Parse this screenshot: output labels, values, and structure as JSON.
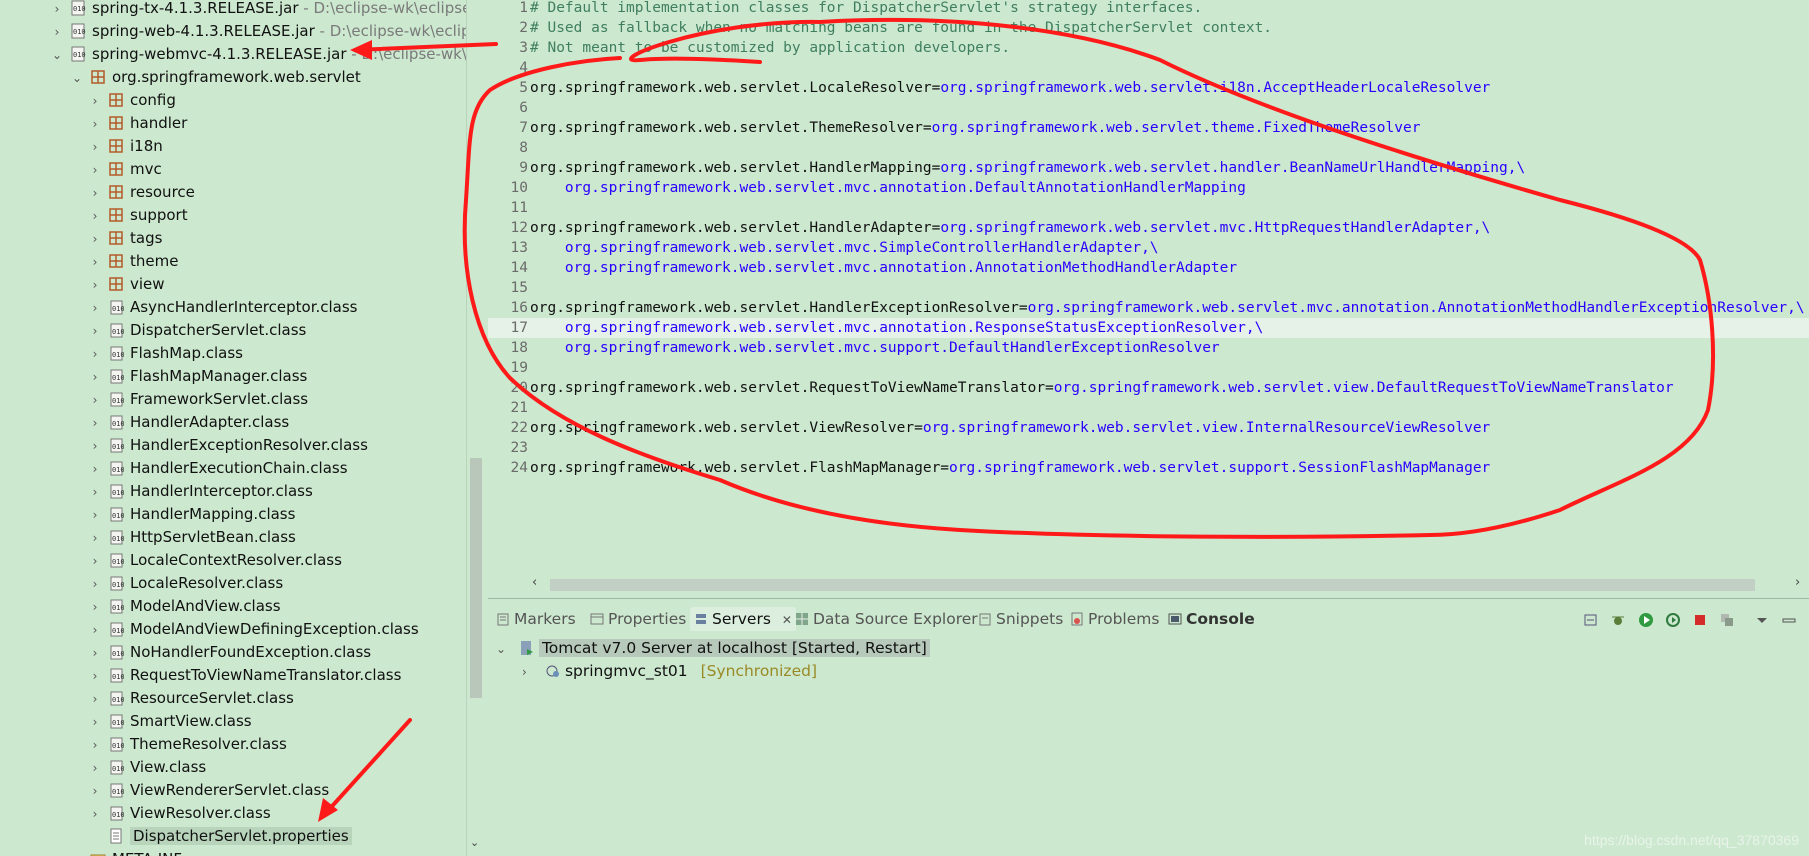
{
  "explorer": {
    "items": [
      {
        "label": "spring-tx-4.1.3.RELEASE.jar",
        "path": " - D:\\eclipse-wk\\eclipse-c",
        "kind": "jar",
        "chev": "›",
        "indent": 0
      },
      {
        "label": "spring-web-4.1.3.RELEASE.jar",
        "path": " - D:\\eclipse-wk\\eclipse",
        "kind": "jar",
        "chev": "›",
        "indent": 0
      },
      {
        "label": "spring-webmvc-4.1.3.RELEASE.jar",
        "path": " - D:\\eclipse-wk\\ec",
        "kind": "jar",
        "chev": "⌄",
        "indent": 0
      },
      {
        "label": "org.springframework.web.servlet",
        "path": "",
        "kind": "package",
        "chev": "⌄",
        "indent": 1
      },
      {
        "label": "config",
        "path": "",
        "kind": "package",
        "chev": "›",
        "indent": 2
      },
      {
        "label": "handler",
        "path": "",
        "kind": "package",
        "chev": "›",
        "indent": 2
      },
      {
        "label": "i18n",
        "path": "",
        "kind": "package",
        "chev": "›",
        "indent": 2
      },
      {
        "label": "mvc",
        "path": "",
        "kind": "package",
        "chev": "›",
        "indent": 2
      },
      {
        "label": "resource",
        "path": "",
        "kind": "package",
        "chev": "›",
        "indent": 2
      },
      {
        "label": "support",
        "path": "",
        "kind": "package",
        "chev": "›",
        "indent": 2
      },
      {
        "label": "tags",
        "path": "",
        "kind": "package",
        "chev": "›",
        "indent": 2
      },
      {
        "label": "theme",
        "path": "",
        "kind": "package",
        "chev": "›",
        "indent": 2
      },
      {
        "label": "view",
        "path": "",
        "kind": "package",
        "chev": "›",
        "indent": 2
      },
      {
        "label": "AsyncHandlerInterceptor.class",
        "path": "",
        "kind": "class",
        "chev": "›",
        "indent": 2
      },
      {
        "label": "DispatcherServlet.class",
        "path": "",
        "kind": "class",
        "chev": "›",
        "indent": 2
      },
      {
        "label": "FlashMap.class",
        "path": "",
        "kind": "class",
        "chev": "›",
        "indent": 2
      },
      {
        "label": "FlashMapManager.class",
        "path": "",
        "kind": "class",
        "chev": "›",
        "indent": 2
      },
      {
        "label": "FrameworkServlet.class",
        "path": "",
        "kind": "class",
        "chev": "›",
        "indent": 2
      },
      {
        "label": "HandlerAdapter.class",
        "path": "",
        "kind": "class",
        "chev": "›",
        "indent": 2
      },
      {
        "label": "HandlerExceptionResolver.class",
        "path": "",
        "kind": "class",
        "chev": "›",
        "indent": 2
      },
      {
        "label": "HandlerExecutionChain.class",
        "path": "",
        "kind": "class",
        "chev": "›",
        "indent": 2
      },
      {
        "label": "HandlerInterceptor.class",
        "path": "",
        "kind": "class",
        "chev": "›",
        "indent": 2
      },
      {
        "label": "HandlerMapping.class",
        "path": "",
        "kind": "class",
        "chev": "›",
        "indent": 2
      },
      {
        "label": "HttpServletBean.class",
        "path": "",
        "kind": "class",
        "chev": "›",
        "indent": 2
      },
      {
        "label": "LocaleContextResolver.class",
        "path": "",
        "kind": "class",
        "chev": "›",
        "indent": 2
      },
      {
        "label": "LocaleResolver.class",
        "path": "",
        "kind": "class",
        "chev": "›",
        "indent": 2
      },
      {
        "label": "ModelAndView.class",
        "path": "",
        "kind": "class",
        "chev": "›",
        "indent": 2
      },
      {
        "label": "ModelAndViewDefiningException.class",
        "path": "",
        "kind": "class",
        "chev": "›",
        "indent": 2
      },
      {
        "label": "NoHandlerFoundException.class",
        "path": "",
        "kind": "class",
        "chev": "›",
        "indent": 2
      },
      {
        "label": "RequestToViewNameTranslator.class",
        "path": "",
        "kind": "class",
        "chev": "›",
        "indent": 2
      },
      {
        "label": "ResourceServlet.class",
        "path": "",
        "kind": "class",
        "chev": "›",
        "indent": 2
      },
      {
        "label": "SmartView.class",
        "path": "",
        "kind": "class",
        "chev": "›",
        "indent": 2
      },
      {
        "label": "ThemeResolver.class",
        "path": "",
        "kind": "class",
        "chev": "›",
        "indent": 2
      },
      {
        "label": "View.class",
        "path": "",
        "kind": "class",
        "chev": "›",
        "indent": 2
      },
      {
        "label": "ViewRendererServlet.class",
        "path": "",
        "kind": "class",
        "chev": "›",
        "indent": 2
      },
      {
        "label": "ViewResolver.class",
        "path": "",
        "kind": "class",
        "chev": "›",
        "indent": 2
      },
      {
        "label": "DispatcherServlet.properties",
        "path": "",
        "kind": "file",
        "chev": "",
        "indent": 2,
        "selected": true
      },
      {
        "label": "META-INF",
        "path": "",
        "kind": "folder",
        "chev": "›",
        "indent": 1
      }
    ]
  },
  "editor": {
    "lines": [
      {
        "n": "1",
        "parts": [
          {
            "t": "comment",
            "s": "# Default implementation classes for DispatcherServlet's strategy interfaces."
          }
        ]
      },
      {
        "n": "2",
        "parts": [
          {
            "t": "comment",
            "s": "# Used as fallback when no matching beans are found in the DispatcherServlet context."
          }
        ]
      },
      {
        "n": "3",
        "parts": [
          {
            "t": "comment",
            "s": "# Not meant to be customized by application developers."
          }
        ]
      },
      {
        "n": "4",
        "parts": []
      },
      {
        "n": "5",
        "parts": [
          {
            "t": "key",
            "s": "org.springframework.web.servlet.LocaleResolver="
          },
          {
            "t": "val",
            "s": "org.springframework.web.servlet.i18n.AcceptHeaderLocaleResolver"
          }
        ]
      },
      {
        "n": "6",
        "parts": []
      },
      {
        "n": "7",
        "parts": [
          {
            "t": "key",
            "s": "org.springframework.web.servlet.ThemeResolver="
          },
          {
            "t": "val",
            "s": "org.springframework.web.servlet.theme.FixedThemeResolver"
          }
        ]
      },
      {
        "n": "8",
        "parts": []
      },
      {
        "n": "9",
        "parts": [
          {
            "t": "key",
            "s": "org.springframework.web.servlet.HandlerMapping="
          },
          {
            "t": "val",
            "s": "org.springframework.web.servlet.handler.BeanNameUrlHandlerMapping,\\"
          }
        ]
      },
      {
        "n": "10",
        "parts": [
          {
            "t": "val",
            "s": "    org.springframework.web.servlet.mvc.annotation.DefaultAnnotationHandlerMapping"
          }
        ]
      },
      {
        "n": "11",
        "parts": []
      },
      {
        "n": "12",
        "parts": [
          {
            "t": "key",
            "s": "org.springframework.web.servlet.HandlerAdapter="
          },
          {
            "t": "val",
            "s": "org.springframework.web.servlet.mvc.HttpRequestHandlerAdapter,\\"
          }
        ]
      },
      {
        "n": "13",
        "parts": [
          {
            "t": "val",
            "s": "    org.springframework.web.servlet.mvc.SimpleControllerHandlerAdapter,\\"
          }
        ]
      },
      {
        "n": "14",
        "parts": [
          {
            "t": "val",
            "s": "    org.springframework.web.servlet.mvc.annotation.AnnotationMethodHandlerAdapter"
          }
        ]
      },
      {
        "n": "15",
        "parts": []
      },
      {
        "n": "16",
        "parts": [
          {
            "t": "key",
            "s": "org.springframework.web.servlet.HandlerExceptionResolver="
          },
          {
            "t": "val",
            "s": "org.springframework.web.servlet.mvc.annotation.AnnotationMethodHandlerExceptionResolver,\\"
          }
        ]
      },
      {
        "n": "17",
        "parts": [
          {
            "t": "val",
            "s": "    org.springframework.web.servlet.mvc.annotation.ResponseStatusExceptionResolver,\\"
          }
        ],
        "current": true
      },
      {
        "n": "18",
        "parts": [
          {
            "t": "val",
            "s": "    org.springframework.web.servlet.mvc.support.DefaultHandlerExceptionResolver"
          }
        ]
      },
      {
        "n": "19",
        "parts": []
      },
      {
        "n": "20",
        "parts": [
          {
            "t": "key",
            "s": "org.springframework.web.servlet.RequestToViewNameTranslator="
          },
          {
            "t": "val",
            "s": "org.springframework.web.servlet.view.DefaultRequestToViewNameTranslator"
          }
        ]
      },
      {
        "n": "21",
        "parts": []
      },
      {
        "n": "22",
        "parts": [
          {
            "t": "key",
            "s": "org.springframework.web.servlet.ViewResolver="
          },
          {
            "t": "val",
            "s": "org.springframework.web.servlet.view.InternalResourceViewResolver"
          }
        ]
      },
      {
        "n": "23",
        "parts": []
      },
      {
        "n": "24",
        "parts": [
          {
            "t": "key",
            "s": "org.springframework.web.servlet.FlashMapManager="
          },
          {
            "t": "val",
            "s": "org.springframework.web.servlet.support.SessionFlashMapManager"
          }
        ]
      }
    ]
  },
  "panel": {
    "tabs": {
      "markers": "Markers",
      "properties": "Properties",
      "servers": "Servers",
      "close": "✕",
      "datasource": "Data Source Explorer",
      "snippets": "Snippets",
      "problems": "Problems",
      "console": "Console"
    },
    "server": {
      "name": "Tomcat v7.0 Server at localhost  [Started, Restart]",
      "child": "springmvc_st01",
      "child_status": "[Synchronized]"
    }
  },
  "watermark": "https://blog.csdn.net/qq_37870369",
  "colors": {
    "annotation": "#ff1a1a",
    "comment": "#3f7f5f",
    "value": "#2a00ff",
    "background": "#cce8cf"
  }
}
